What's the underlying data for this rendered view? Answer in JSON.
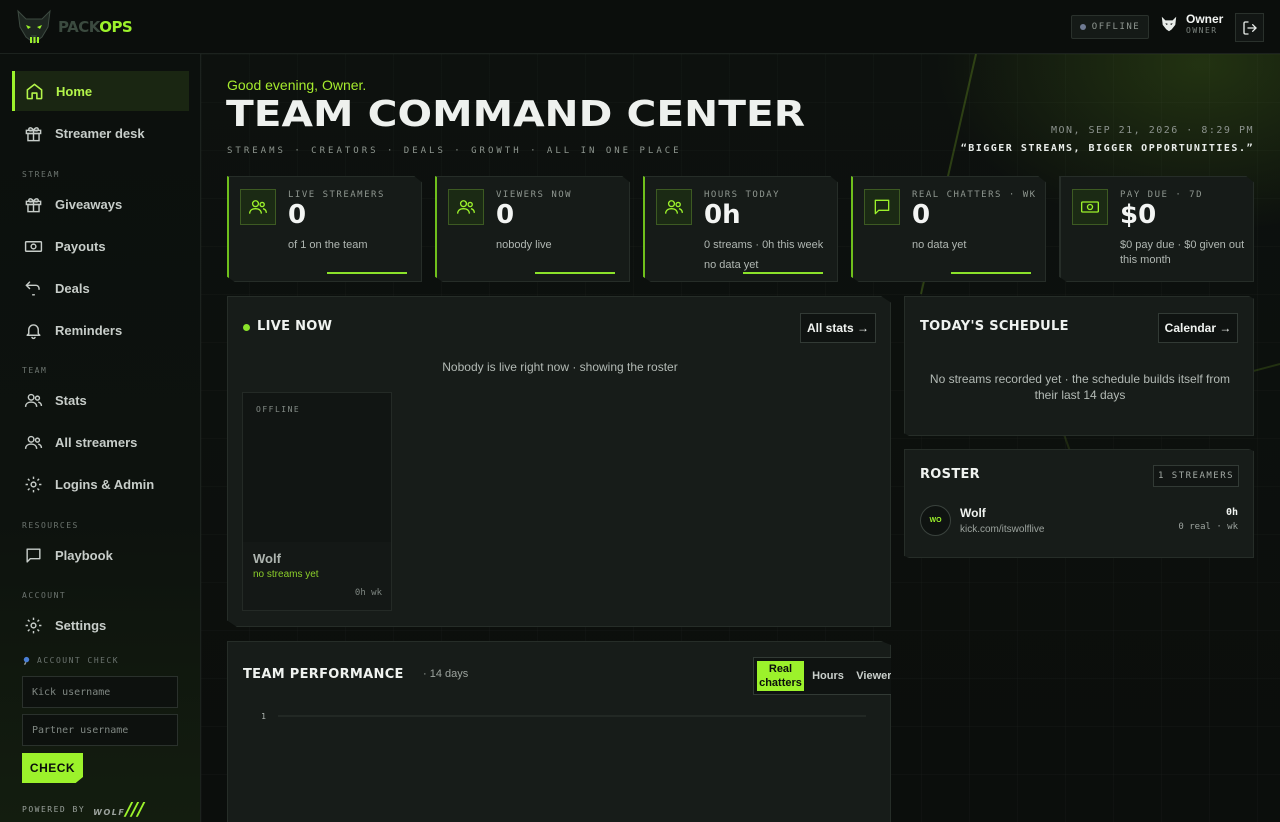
{
  "brand": {
    "part1": "PACK",
    "part2": "OPS"
  },
  "topbar": {
    "status": "OFFLINE",
    "user_name": "Owner",
    "user_role": "OWNER"
  },
  "sidebar": {
    "nav_home": "Home",
    "nav_streamer_desk": "Streamer desk",
    "section_stream": "STREAM",
    "nav_giveaways": "Giveaways",
    "nav_payouts": "Payouts",
    "nav_deals": "Deals",
    "nav_reminders": "Reminders",
    "section_team": "TEAM",
    "nav_stats": "Stats",
    "nav_all_streamers": "All streamers",
    "nav_logins_admin": "Logins & Admin",
    "section_resources": "RESOURCES",
    "nav_playbook": "Playbook",
    "section_account": "ACCOUNT",
    "nav_settings": "Settings",
    "account_check_label": "ACCOUNT CHECK",
    "kick_placeholder": "Kick username",
    "partner_placeholder": "Partner username",
    "check_button": "CHECK",
    "powered_by": "POWERED BY",
    "powered_brand": "WOLF",
    "powered_slashes": "///"
  },
  "header": {
    "greeting": "Good evening, Owner.",
    "title": "TEAM COMMAND CENTER",
    "tagline": "STREAMS · CREATORS · DEALS · GROWTH · ALL IN ONE PLACE",
    "datetime": "MON, SEP 21, 2026 · 8:29 PM",
    "slogan": "“BIGGER STREAMS, BIGGER OPPORTUNITIES.”"
  },
  "stats": [
    {
      "label": "LIVE STREAMERS",
      "value": "0",
      "sub": "of 1 on the team",
      "sub2": "",
      "icon": "users-icon"
    },
    {
      "label": "VIEWERS NOW",
      "value": "0",
      "sub": "nobody live",
      "sub2": "",
      "icon": "users-icon"
    },
    {
      "label": "HOURS TODAY",
      "value": "0h",
      "sub": "0 streams · 0h this week",
      "sub2": "no data yet",
      "icon": "users-icon"
    },
    {
      "label": "REAL CHATTERS · WK",
      "value": "0",
      "sub": "no data yet",
      "sub2": "",
      "icon": "chat-icon"
    },
    {
      "label": "PAY DUE · 7D",
      "value": "$0",
      "sub": "$0 pay due · $0 given out this month",
      "sub2": "",
      "icon": "cash-icon"
    }
  ],
  "live_now": {
    "title": "LIVE NOW",
    "button": "All stats →",
    "note": "Nobody is live right now · showing the roster",
    "card": {
      "status": "OFFLINE",
      "name": "Wolf",
      "sub": "no streams yet",
      "hours": "0h wk"
    }
  },
  "schedule": {
    "title": "TODAY'S SCHEDULE",
    "button": "Calendar →",
    "note": "No streams recorded yet · the schedule builds itself from their last 14 days"
  },
  "roster": {
    "title": "ROSTER",
    "chip": "1 STREAMERS",
    "rows": [
      {
        "initials": "WO",
        "name": "Wolf",
        "link": "kick.com/itswolflive",
        "hours": "0h",
        "detail": "0 real · wk"
      }
    ]
  },
  "performance": {
    "title": "TEAM PERFORMANCE",
    "subtitle": "· 14 days",
    "tabs": [
      "Real chatters",
      "Hours",
      "Viewers"
    ],
    "active_tab": "Real chatters"
  },
  "chart_data": {
    "type": "line",
    "title": "TEAM PERFORMANCE",
    "yticks": [
      "1"
    ],
    "series": []
  },
  "colors": {
    "accent": "#9cf22b",
    "background": "#0b0e0c",
    "panel": "#171c19"
  }
}
